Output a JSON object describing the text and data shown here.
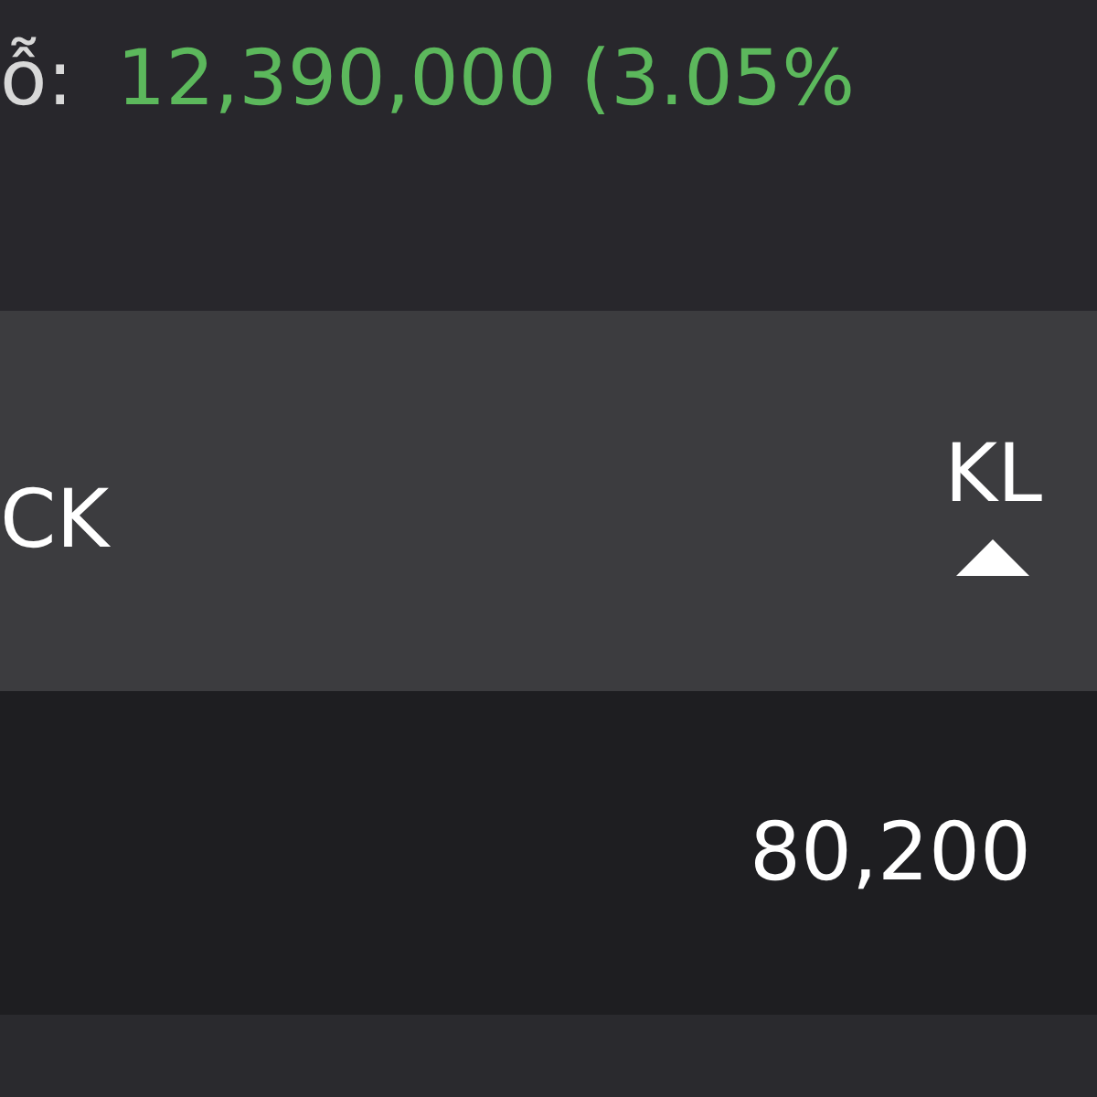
{
  "summary": {
    "label": "ỗ:",
    "value": "12,390,000 (3.05%"
  },
  "table": {
    "columns": [
      {
        "label": "CK",
        "sorted": false
      },
      {
        "label": "KL",
        "sorted": true
      }
    ],
    "rows": [
      {
        "cells": [
          "",
          "80,200"
        ]
      }
    ]
  }
}
